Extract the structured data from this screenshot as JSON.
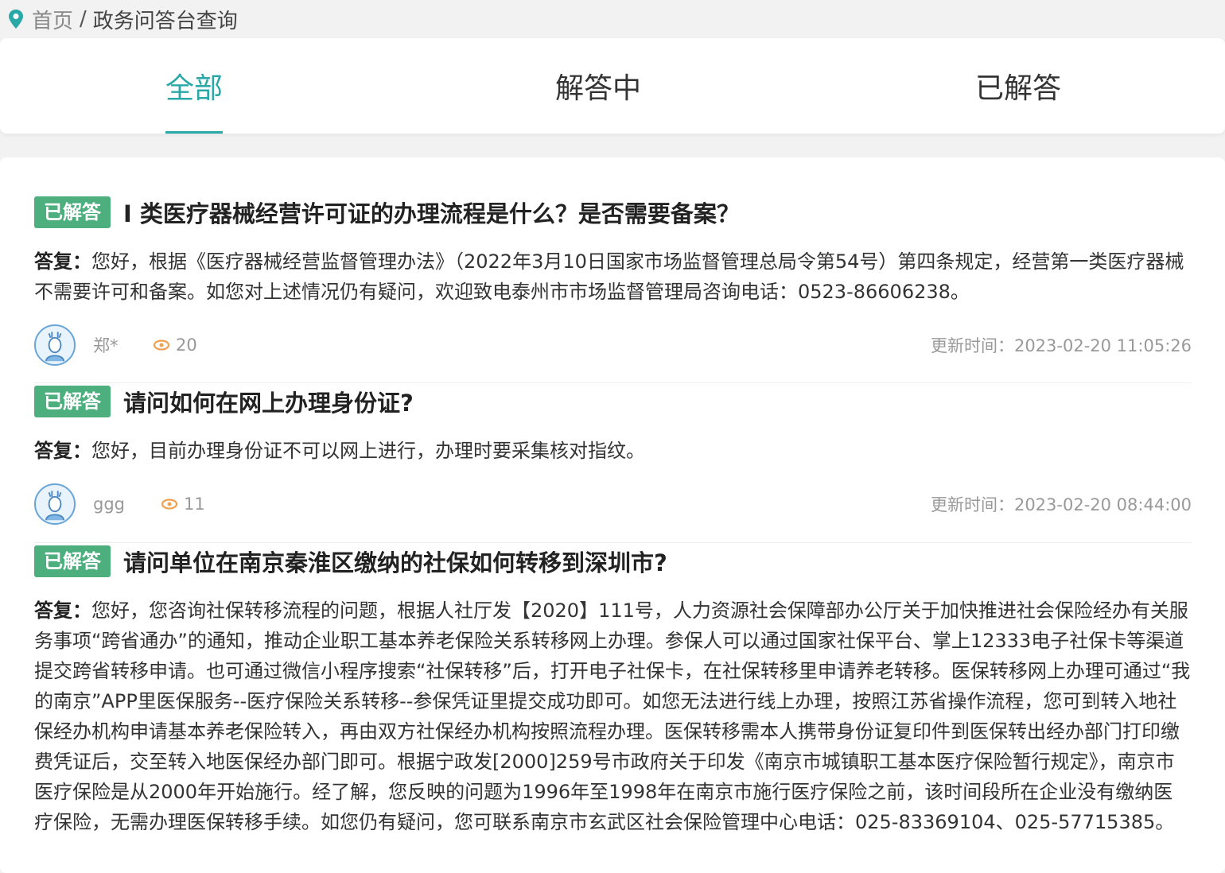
{
  "breadcrumb": {
    "home": "首页",
    "separator": "/",
    "current": "政务问答台查询",
    "icon": "location-pin-icon"
  },
  "tabs": [
    {
      "label": "全部",
      "active": true
    },
    {
      "label": "解答中",
      "active": false
    },
    {
      "label": "已解答",
      "active": false
    }
  ],
  "colors": {
    "accent": "#2aa8a8",
    "badge": "#4caf7d",
    "eye_icon": "#f0a050",
    "avatar_border": "#6aa5d8"
  },
  "items": [
    {
      "badge": "已解答",
      "title": "I 类医疗器械经营许可证的办理流程是什么？是否需要备案？",
      "answer_label": "答复：",
      "answer": "您好，根据《医疗器械经营监督管理办法》（2022年3月10日国家市场监督管理总局令第54号）第四条规定，经营第一类医疗器械不需要许可和备案。如您对上述情况仍有疑问，欢迎致电泰州市市场监督管理局咨询电话：0523-86606238。",
      "author": "郑*",
      "views": "20",
      "updated": "更新时间：2023-02-20 11:05:26"
    },
    {
      "badge": "已解答",
      "title": "请问如何在网上办理身份证?",
      "answer_label": "答复：",
      "answer": "您好，目前办理身份证不可以网上进行，办理时要采集核对指纹。",
      "author": "ggg",
      "views": "11",
      "updated": "更新时间：2023-02-20 08:44:00"
    },
    {
      "badge": "已解答",
      "title": "请问单位在南京秦淮区缴纳的社保如何转移到深圳市?",
      "answer_label": "答复：",
      "answer": "您好，您咨询社保转移流程的问题，根据人社厅发【2020】111号，人力资源社会保障部办公厅关于加快推进社会保险经办有关服务事项“跨省通办”的通知，推动企业职工基本养老保险关系转移网上办理。参保人可以通过国家社保平台、掌上12333电子社保卡等渠道提交跨省转移申请。也可通过微信小程序搜索“社保转移”后，打开电子社保卡，在社保转移里申请养老转移。医保转移网上办理可通过“我的南京”APP里医保服务--医疗保险关系转移--参保凭证里提交成功即可。如您无法进行线上办理，按照江苏省操作流程，您可到转入地社保经办机构申请基本养老保险转入，再由双方社保经办机构按照流程办理。医保转移需本人携带身份证复印件到医保转出经办部门打印缴费凭证后，交至转入地医保经办部门即可。根据宁政发[2000]259号市政府关于印发《南京市城镇职工基本医疗保险暂行规定》，南京市医疗保险是从2000年开始施行。经了解，您反映的问题为1996年至1998年在南京市施行医疗保险之前，该时间段所在企业没有缴纳医疗保险，无需办理医保转移手续。如您仍有疑问，您可联系南京市玄武区社会保险管理中心电话：025-83369104、025-57715385。"
    }
  ]
}
